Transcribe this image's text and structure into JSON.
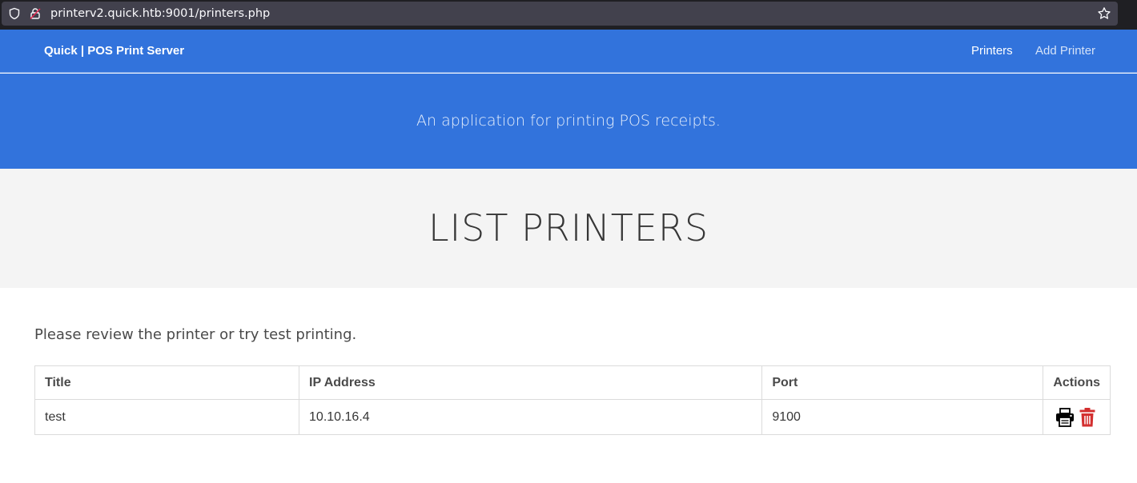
{
  "browser": {
    "url": "printerv2.quick.htb:9001/printers.php",
    "icons": [
      "shield-icon",
      "lock-icon",
      "star-icon"
    ]
  },
  "navbar": {
    "brand": "Quick | POS Print Server",
    "links": [
      {
        "label": "Printers",
        "active": true
      },
      {
        "label": "Add Printer",
        "active": false
      }
    ],
    "color": "#3273dc"
  },
  "hero": {
    "subtitle": "An application for printing POS receipts."
  },
  "header": {
    "title": "LIST PRINTERS"
  },
  "content": {
    "intro": "Please review the printer or try test printing.",
    "table": {
      "columns": [
        "Title",
        "IP Address",
        "Port",
        "Actions"
      ],
      "rows": [
        {
          "title": "test",
          "ip": "10.10.16.4",
          "port": "9100",
          "actions": [
            "printer-icon",
            "trash-icon"
          ]
        }
      ]
    },
    "delete_color": "#d32f2f"
  }
}
